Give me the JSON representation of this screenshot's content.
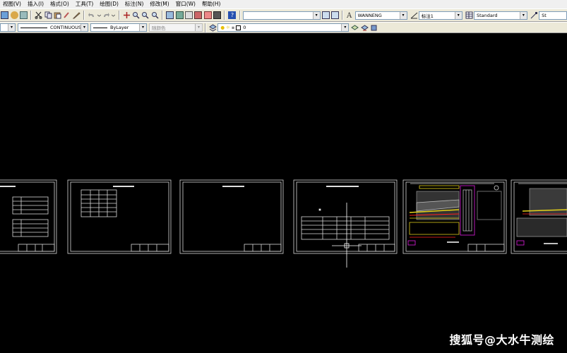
{
  "menu": [
    "视图(V)",
    "插入(I)",
    "格式(O)",
    "工具(T)",
    "绘图(D)",
    "标注(N)",
    "修改(M)",
    "窗口(W)",
    "帮助(H)"
  ],
  "toolbar1": {
    "textstyle_value": "WANNENG",
    "dimstyle_value": "标注1",
    "tablestyle_value": "Standard",
    "mleaderstyle_value": "St"
  },
  "toolbar2": {
    "linetype_value": "CONTINUOUS",
    "lineweight_value": "ByLayer",
    "plotstyle_value": "随颜色",
    "layer_value": "0"
  },
  "colors": {
    "canvas": "#000000",
    "toolbar": "#ece9d8",
    "sheet_line": "#d8d8d8",
    "accent_red": "#ff2020",
    "accent_yellow": "#e6d21a",
    "accent_magenta": "#e020e0"
  },
  "watermark": "搜狐号@大水牛测绘"
}
